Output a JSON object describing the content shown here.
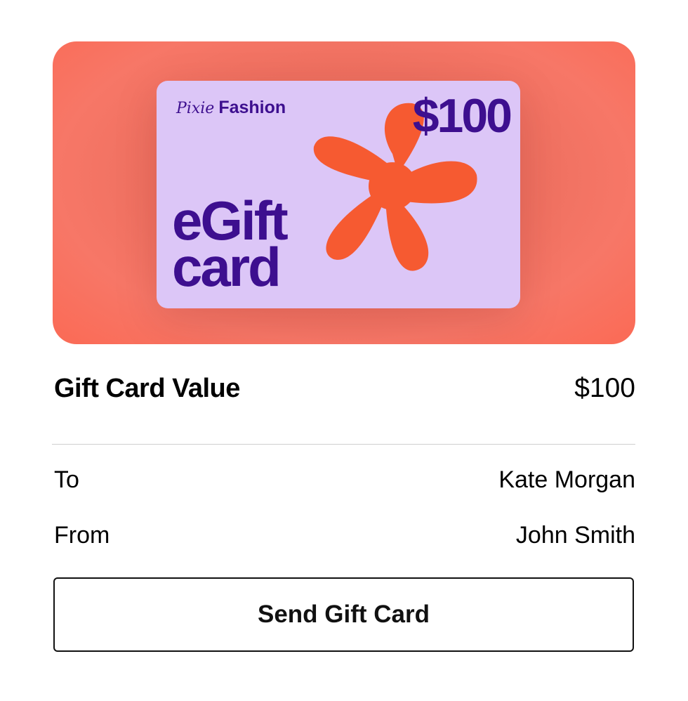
{
  "gift_card_image": {
    "brand_script": "Pixie",
    "brand_bold": "Fashion",
    "amount": "$100",
    "title_line1": "eGift",
    "title_line2": "card",
    "background_color": "#f26f61",
    "card_color": "#dcc6f7",
    "text_color": "#3d0f8f",
    "flower_color": "#f65a31"
  },
  "value": {
    "label": "Gift Card Value",
    "amount": "$100"
  },
  "recipient": {
    "label": "To",
    "name": "Kate Morgan"
  },
  "sender": {
    "label": "From",
    "name": "John Smith"
  },
  "actions": {
    "send_label": "Send Gift Card"
  }
}
